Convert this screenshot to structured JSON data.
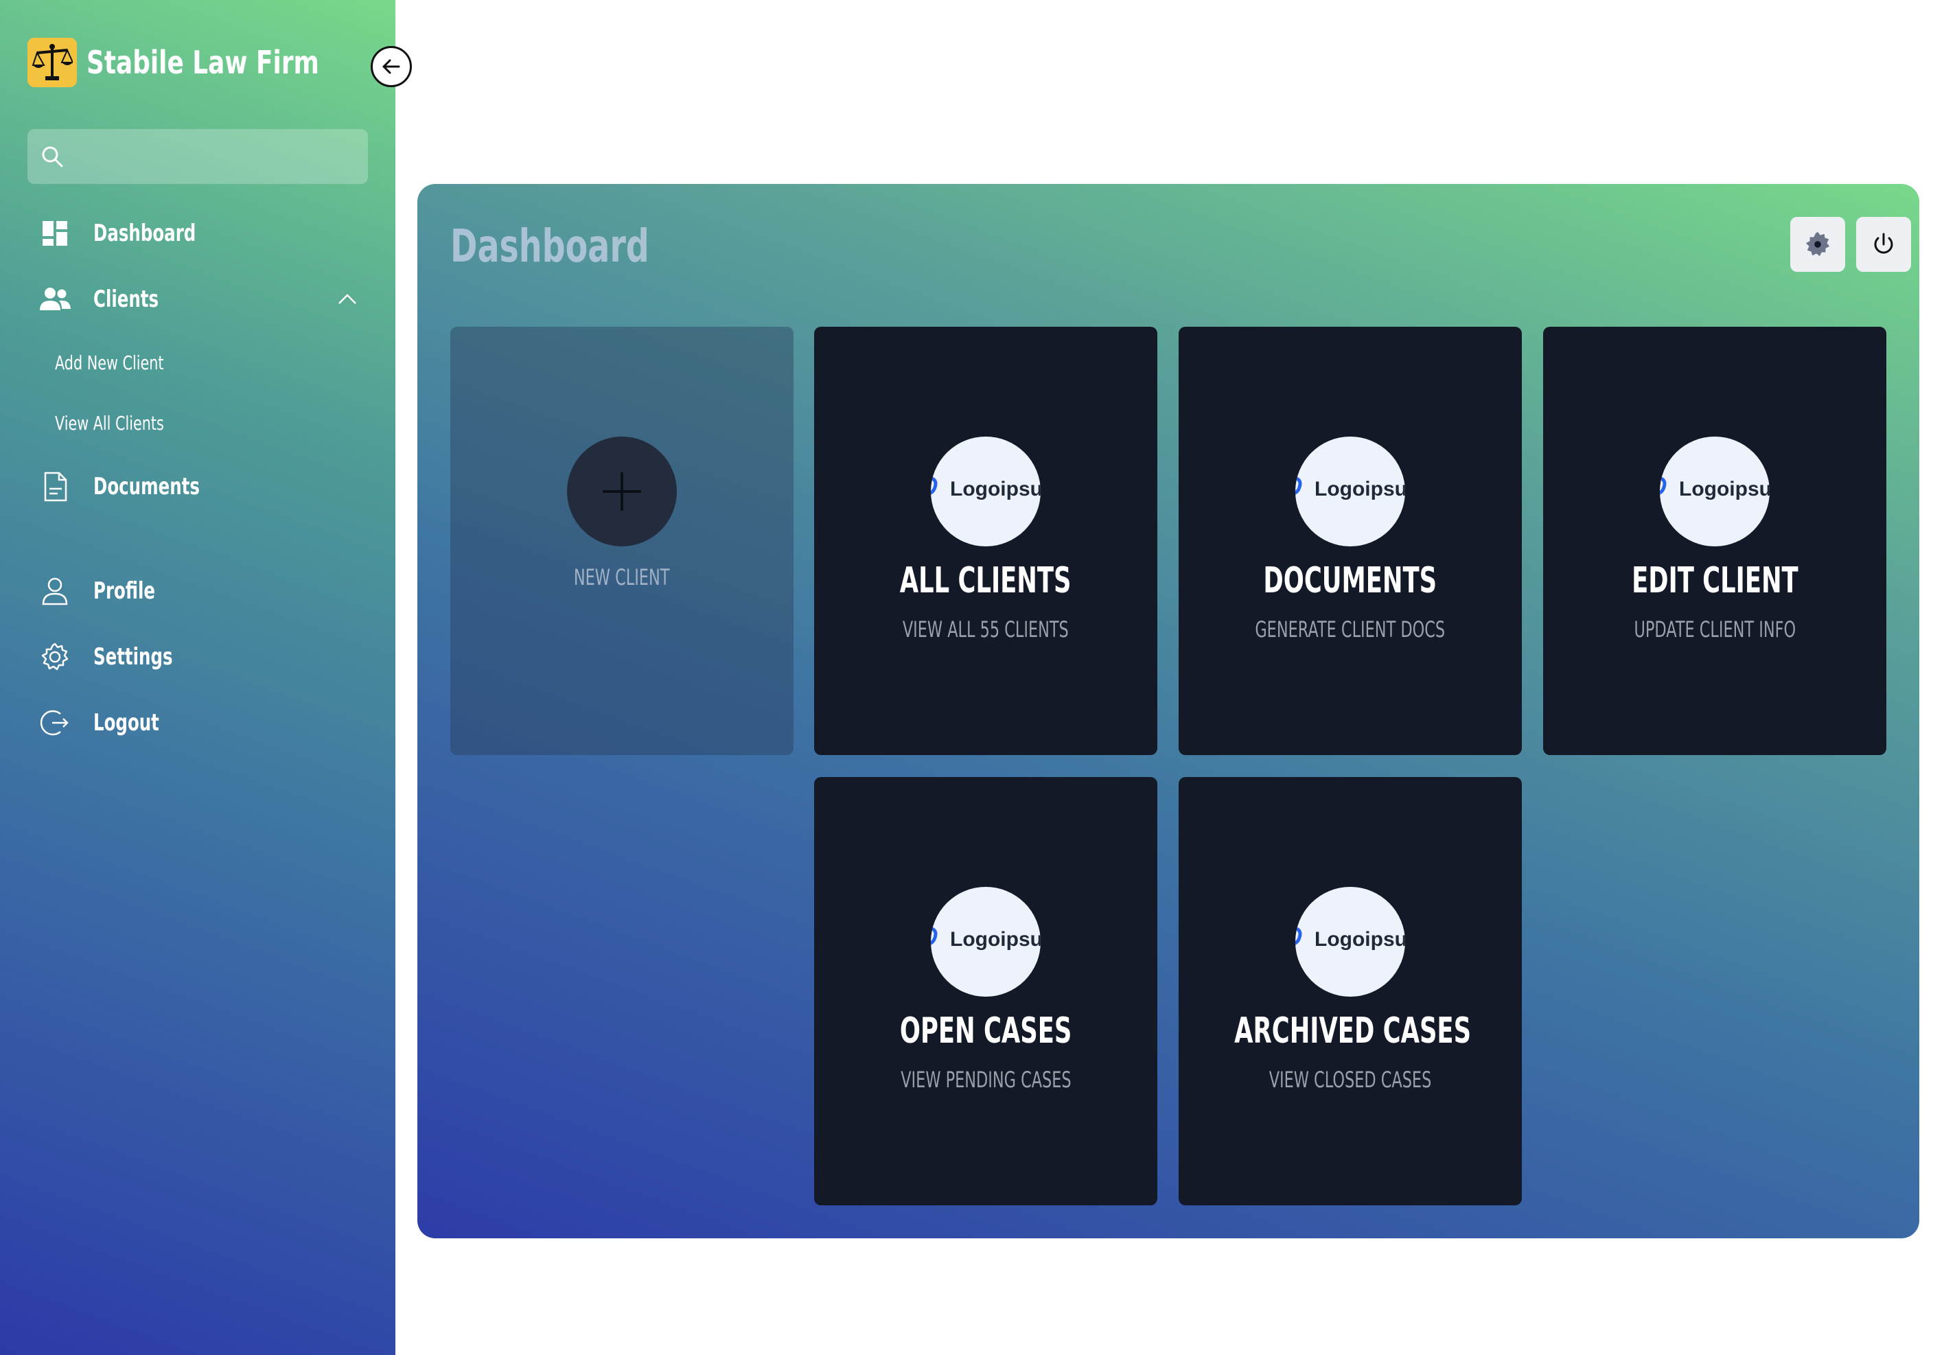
{
  "app": {
    "title": "Stabile Law Firm"
  },
  "search": {
    "placeholder": ""
  },
  "sidebar": {
    "items": [
      {
        "label": "Dashboard",
        "icon": "dashboard-icon"
      },
      {
        "label": "Clients",
        "icon": "users-icon",
        "expanded": true
      },
      {
        "label": "Documents",
        "icon": "document-icon"
      },
      {
        "label": "Profile",
        "icon": "user-icon"
      },
      {
        "label": "Settings",
        "icon": "gear-icon"
      },
      {
        "label": "Logout",
        "icon": "logout-icon"
      }
    ],
    "clients_submenu": [
      {
        "label": "Add New Client"
      },
      {
        "label": "View All Clients"
      }
    ]
  },
  "main": {
    "title": "Dashboard",
    "cards": [
      {
        "title": "",
        "subtitle": "NEW CLIENT",
        "icon": "plus-icon"
      },
      {
        "title": "ALL CLIENTS",
        "subtitle": "VIEW ALL 55 CLIENTS",
        "logo": "Logoipsu"
      },
      {
        "title": "DOCUMENTS",
        "subtitle": "GENERATE CLIENT DOCS",
        "logo": "Logoipsu"
      },
      {
        "title": "EDIT CLIENT",
        "subtitle": "UPDATE CLIENT INFO",
        "logo": "Logoipsu"
      },
      {
        "title": "OPEN CASES",
        "subtitle": "VIEW PENDING CASES",
        "logo": "Logoipsu"
      },
      {
        "title": "ARCHIVED CASES",
        "subtitle": "VIEW CLOSED CASES",
        "logo": "Logoipsu"
      }
    ]
  },
  "colors": {
    "gradient_top": "#78d88a",
    "gradient_bottom": "#2c3aa8",
    "card_bg": "#141927",
    "brand_logo_bg": "#f3c23e"
  }
}
